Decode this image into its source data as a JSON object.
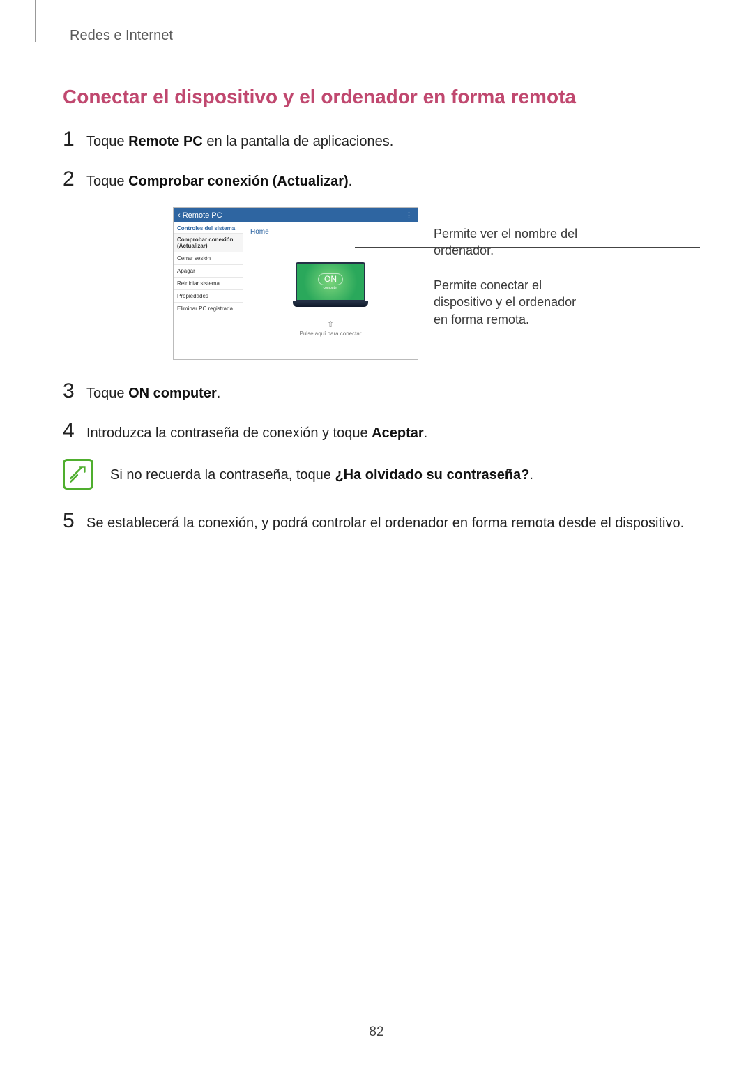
{
  "breadcrumb": "Redes e Internet",
  "heading": "Conectar el dispositivo y el ordenador en forma remota",
  "steps": {
    "s1": {
      "pre": "Toque ",
      "bold": "Remote PC",
      "post": " en la pantalla de aplicaciones."
    },
    "s2": {
      "pre": "Toque ",
      "bold": "Comprobar conexión (Actualizar)",
      "post": "."
    },
    "s3": {
      "pre": "Toque ",
      "bold": "ON computer",
      "post": "."
    },
    "s4": {
      "pre": "Introduzca la contraseña de conexión y toque ",
      "bold": "Aceptar",
      "post": "."
    },
    "s5": {
      "pre": "Se establecerá la conexión, y podrá controlar el ordenador en forma remota desde el dispositivo.",
      "bold": "",
      "post": ""
    }
  },
  "note": {
    "pre": "Si no recuerda la contraseña, toque ",
    "bold": "¿Ha olvidado su contraseña?",
    "post": "."
  },
  "device": {
    "title": "Remote PC",
    "back": "‹",
    "menu": "⋮",
    "sidebar_title": "Controles del sistema",
    "items": [
      "Comprobar conexión (Actualizar)",
      "Cerrar sesión",
      "Apagar",
      "Reiniciar sistema",
      "Propiedades",
      "Eliminar PC registrada"
    ],
    "pc_name": "Home",
    "on_label": "ON",
    "on_sub": "computer",
    "tap_hint": "Pulse aquí para conectar"
  },
  "callouts": {
    "c1": "Permite ver el nombre del ordenador.",
    "c2": "Permite conectar el dispositivo y el ordenador en forma remota."
  },
  "page_number": "82"
}
